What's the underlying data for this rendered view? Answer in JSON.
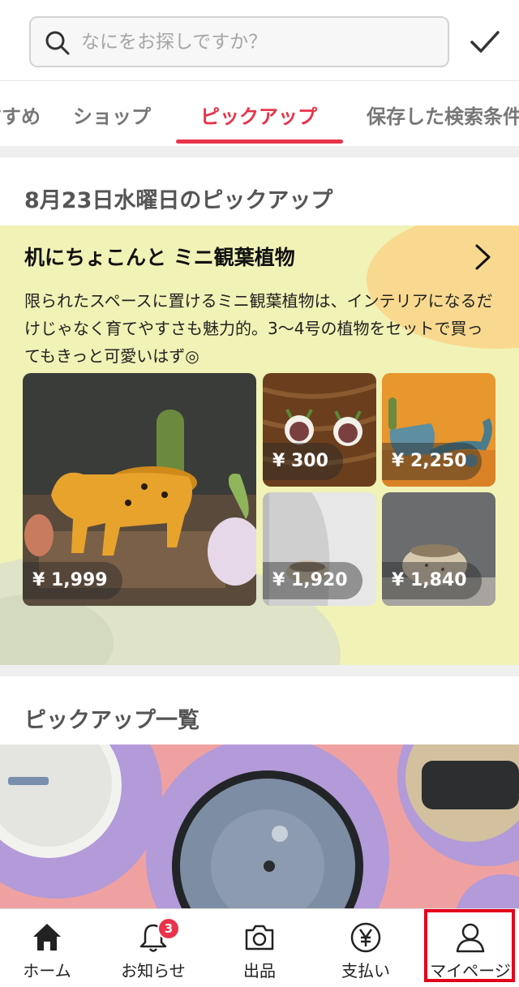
{
  "search": {
    "placeholder": "なにをお探しですか？"
  },
  "tabs": [
    {
      "label": "すすめ"
    },
    {
      "label": "ショップ"
    },
    {
      "label": "ピックアップ",
      "active": true
    },
    {
      "label": "保存した検索条件"
    }
  ],
  "pickup": {
    "section_title": "8月23日水曜日のピックアップ",
    "card_title": "机にちょこんと ミニ観葉植物",
    "description": "限られたスペースに置けるミニ観葉植物は、インテリアになるだけじゃなく育てやすさも魅力的。3〜4号の植物をセットで買ってもきっと可愛いはず◎",
    "items": [
      {
        "price": "¥ 1,999",
        "image": "cat-pot-cactus"
      },
      {
        "price": "¥ 300",
        "image": "plant-stickers"
      },
      {
        "price": "¥ 2,250",
        "image": "cat-pot-blue"
      },
      {
        "price": "¥ 1,920",
        "image": "small-pot-gray"
      },
      {
        "price": "¥ 1,840",
        "image": "cat-pot-beige"
      }
    ]
  },
  "pickup_list": {
    "section_title": "ピックアップ一覧"
  },
  "bottom_nav": [
    {
      "label": "ホーム",
      "icon": "home-icon"
    },
    {
      "label": "お知らせ",
      "icon": "bell-icon",
      "badge": "3"
    },
    {
      "label": "出品",
      "icon": "camera-icon"
    },
    {
      "label": "支払い",
      "icon": "yen-icon"
    },
    {
      "label": "マイページ",
      "icon": "user-icon"
    }
  ],
  "colors": {
    "accent": "#e8334a",
    "highlight": "#e3001b",
    "card_bg": "#f1f2b5",
    "banner_bg": "#efa1a1"
  }
}
